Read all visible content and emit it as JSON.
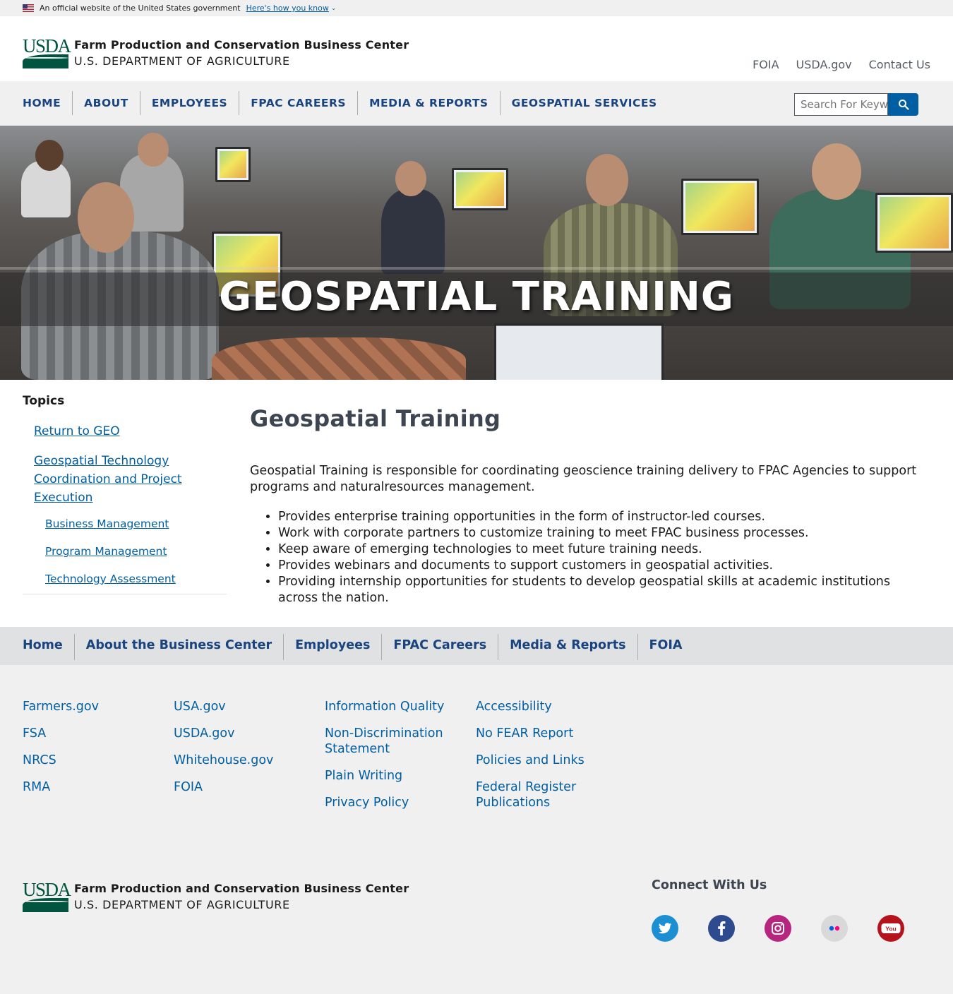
{
  "gov_banner": {
    "official_text": "An official website of the United States government",
    "how_you_know": "Here's how you know"
  },
  "header": {
    "logo_mark": "USDA",
    "org_name": "Farm Production and Conservation Business Center",
    "dept_name": "U.S. DEPARTMENT OF AGRICULTURE",
    "utility_links": [
      "FOIA",
      "USDA.gov",
      "Contact Us"
    ]
  },
  "nav": {
    "items": [
      "HOME",
      "ABOUT",
      "EMPLOYEES",
      "FPAC CAREERS",
      "MEDIA & REPORTS",
      "GEOSPATIAL SERVICES"
    ]
  },
  "search": {
    "placeholder": "Search For Keyw",
    "icon": "search-icon"
  },
  "hero": {
    "title": "GEOSPATIAL TRAINING"
  },
  "sidebar": {
    "heading": "Topics",
    "return_link": "Return to GEO",
    "parent_link": "Geospatial Technology Coordination and Project Execution",
    "sub_links": [
      "Business Management",
      "Program Management",
      "Technology Assessment"
    ]
  },
  "main": {
    "title": "Geospatial Training",
    "intro": "Geospatial Training is responsible for coordinating geoscience training delivery to FPAC Agencies to support programs and naturalresources management.",
    "bullets": [
      "Provides enterprise training opportunities in the form of instructor-led courses.",
      "Work with corporate partners to customize training to meet FPAC business processes.",
      "Keep aware of emerging technologies to meet future training needs.",
      "Provides webinars and documents to support customers in geospatial activities.",
      "Providing internship opportunities for students to develop geospatial skills at academic institutions across the nation."
    ]
  },
  "footer_nav": {
    "items": [
      "Home",
      "About the Business Center",
      "Employees",
      "FPAC Careers",
      "Media & Reports",
      "FOIA"
    ]
  },
  "footer_links": {
    "col1": [
      "Farmers.gov",
      "FSA",
      "NRCS",
      "RMA"
    ],
    "col2": [
      "USA.gov",
      "USDA.gov",
      "Whitehouse.gov",
      "FOIA"
    ],
    "col3": [
      "Information Quality",
      "Non-Discrimination Statement",
      "Plain Writing",
      "Privacy Policy"
    ],
    "col4": [
      "Accessibility",
      "No FEAR Report",
      "Policies and Links",
      "Federal Register Publications"
    ]
  },
  "footer_bottom": {
    "connect_heading": "Connect With Us",
    "social": [
      {
        "icon": "twitter-icon",
        "color": "#1c8fd3"
      },
      {
        "icon": "facebook-icon",
        "color": "#2f4b8f"
      },
      {
        "icon": "instagram-icon",
        "color": "#b6267e"
      },
      {
        "icon": "flickr-icon",
        "color": "#d9d9d9"
      },
      {
        "icon": "youtube-icon",
        "color": "#b5121b"
      }
    ]
  },
  "colors": {
    "nav_text": "#1a4480",
    "link": "#005ea2",
    "usda_green": "#005440"
  }
}
